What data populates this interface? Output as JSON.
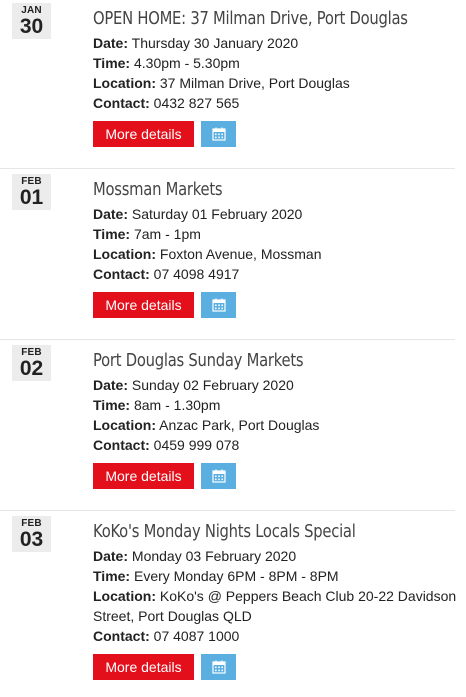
{
  "events": [
    {
      "month": "JAN",
      "day": "30",
      "title": "OPEN HOME: 37 Milman Drive, Port Douglas",
      "date_label": "Date:",
      "date_value": " Thursday 30 January 2020",
      "time_label": "Time:",
      "time_value": " 4.30pm - 5.30pm",
      "location_label": "Location:",
      "location_value": " 37 Milman Drive, Port Douglas",
      "contact_label": "Contact:",
      "contact_value": " 0432 827 565",
      "more_label": "More details",
      "calendar_icon": "calendar-icon"
    },
    {
      "month": "FEB",
      "day": "01",
      "title": "Mossman Markets",
      "date_label": "Date:",
      "date_value": " Saturday 01 February 2020",
      "time_label": "Time:",
      "time_value": " 7am - 1pm",
      "location_label": "Location:",
      "location_value": " Foxton Avenue, Mossman",
      "contact_label": "Contact:",
      "contact_value": " 07 4098 4917",
      "more_label": "More details",
      "calendar_icon": "calendar-icon"
    },
    {
      "month": "FEB",
      "day": "02",
      "title": "Port Douglas Sunday Markets",
      "date_label": "Date:",
      "date_value": " Sunday 02 February 2020",
      "time_label": "Time:",
      "time_value": " 8am - 1.30pm",
      "location_label": "Location:",
      "location_value": " Anzac Park, Port Douglas",
      "contact_label": "Contact:",
      "contact_value": " 0459 999 078",
      "more_label": "More details",
      "calendar_icon": "calendar-icon"
    },
    {
      "month": "FEB",
      "day": "03",
      "title": "KoKo's Monday Nights Locals Special",
      "date_label": "Date:",
      "date_value": " Monday 03 February 2020",
      "time_label": "Time:",
      "time_value": " Every Monday 6PM - 8PM - 8PM",
      "location_label": "Location:",
      "location_value": " KoKo's @ Peppers Beach Club 20-22 Davidson Street, Port Douglas QLD",
      "contact_label": "Contact:",
      "contact_value": " 07 4087 1000",
      "more_label": "More details",
      "calendar_icon": "calendar-icon"
    }
  ],
  "colors": {
    "more_button": "#e3101c",
    "calendar_button": "#5aafe0",
    "date_box": "#ececec",
    "divider": "#e6e6e6"
  }
}
